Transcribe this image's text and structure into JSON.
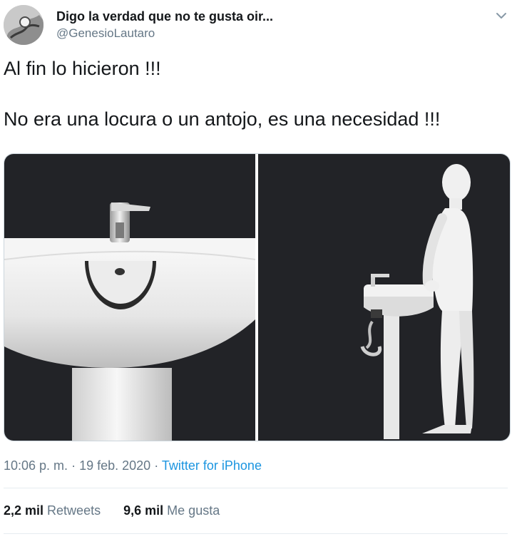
{
  "author": {
    "display_name": "Digo la verdad que no te gusta oir...",
    "handle": "@GenesioLautaro",
    "avatar_icon": "avatar-hand-gesture"
  },
  "menu_icon": "chevron-down-icon",
  "tweet": {
    "text_line1": "Al fin lo hicieron !!!",
    "text_line2": "No era una locura o un antojo, es una necesidad !!!"
  },
  "media": {
    "left_image": "sink-closeup-with-notch",
    "right_image": "mannequin-at-notched-sink"
  },
  "meta": {
    "time": "10:06 p. m.",
    "sep1": "·",
    "date": "19 feb. 2020",
    "sep2": "·",
    "source": "Twitter for iPhone"
  },
  "stats": {
    "retweets_count": "2,2 mil",
    "retweets_label": "Retweets",
    "likes_count": "9,6 mil",
    "likes_label": "Me gusta"
  },
  "colors": {
    "link": "#1b95e0",
    "secondary_text": "#657786",
    "media_bg": "#222327"
  }
}
